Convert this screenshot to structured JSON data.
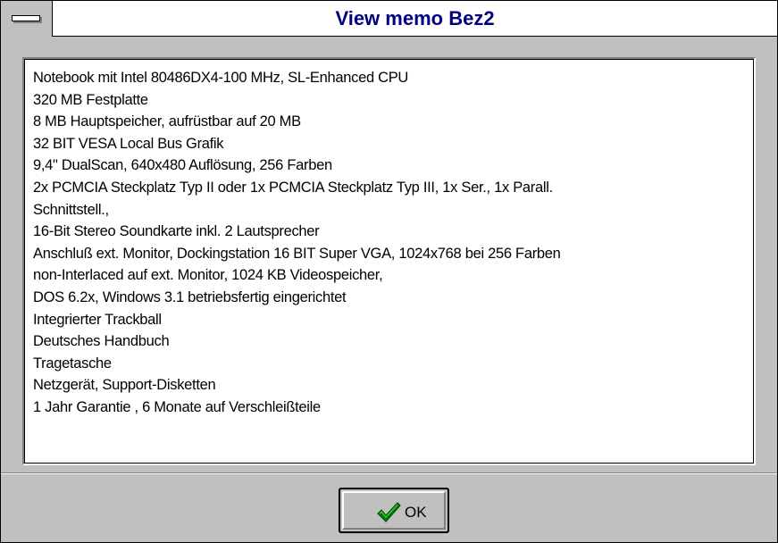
{
  "window": {
    "title": "View memo Bez2"
  },
  "memo": {
    "lines": [
      "Notebook mit Intel 80486DX4-100 MHz, SL-Enhanced CPU",
      "320 MB Festplatte",
      "8 MB Hauptspeicher, aufrüstbar auf 20 MB",
      "32 BIT VESA Local Bus Grafik",
      "9,4\" DualScan, 640x480 Auflösung, 256 Farben",
      "2x PCMCIA Steckplatz Typ II oder 1x PCMCIA Steckplatz Typ III, 1x Ser., 1x Parall.",
      "Schnittstell.,",
      "16-Bit Stereo Soundkarte inkl. 2 Lautsprecher",
      "Anschluß ext. Monitor, Dockingstation 16 BIT Super VGA, 1024x768 bei 256 Farben",
      "non-Interlaced auf ext. Monitor, 1024 KB Videospeicher,",
      "DOS 6.2x, Windows 3.1 betriebsfertig eingerichtet",
      "Integrierter Trackball",
      "Deutsches Handbuch",
      "Tragetasche",
      "Netzgerät, Support-Disketten",
      "1 Jahr Garantie , 6 Monate auf Verschleißteile"
    ]
  },
  "buttons": {
    "ok_label": "OK",
    "ok_icon": "checkmark-icon"
  },
  "colors": {
    "title_text": "#000080",
    "face": "#c0c0c0",
    "checkmark": "#008000"
  }
}
